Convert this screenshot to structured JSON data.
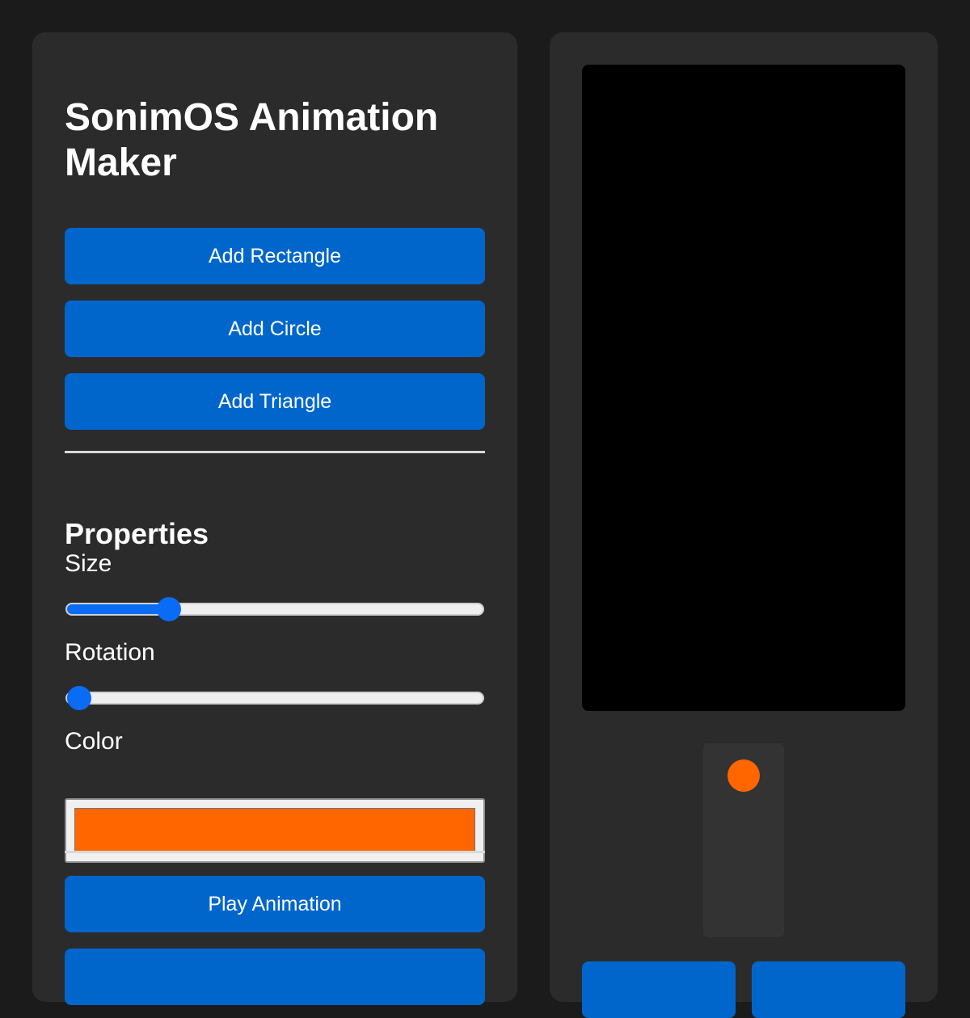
{
  "app": {
    "title": "SonimOS Animation Maker"
  },
  "shapes": {
    "add_rectangle": "Add Rectangle",
    "add_circle": "Add Circle",
    "add_triangle": "Add Triangle"
  },
  "properties": {
    "heading": "Properties",
    "size": {
      "label": "Size",
      "value_fraction": 0.23
    },
    "rotation": {
      "label": "Rotation",
      "value_fraction": 0.0
    },
    "color": {
      "label": "Color",
      "value": "#ff6600"
    }
  },
  "actions": {
    "play_animation": "Play Animation"
  },
  "keyframe": {
    "color": "#ff6600"
  },
  "colors": {
    "accent": "#0066cc",
    "panel": "#2b2b2b",
    "background": "#1b1b1b",
    "canvas": "#000000",
    "slider_fill": "#0a6cf5"
  }
}
